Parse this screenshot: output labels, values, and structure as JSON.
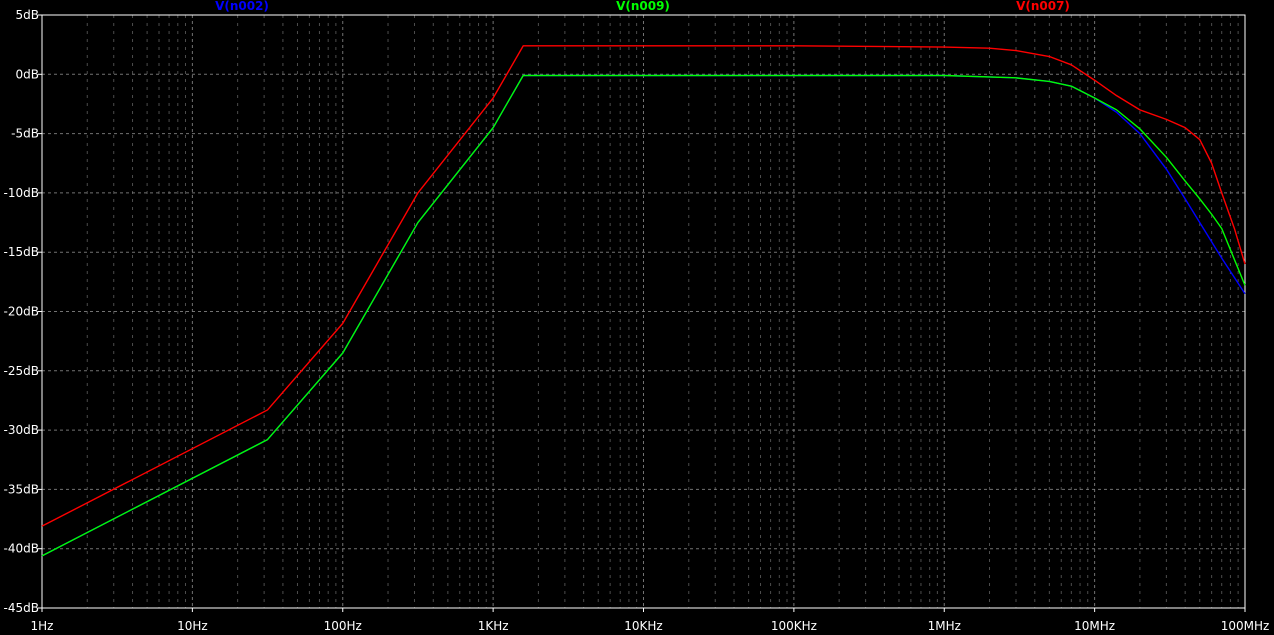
{
  "chart_data": {
    "type": "line",
    "x_scale": "log",
    "xlim": [
      1,
      100000000
    ],
    "ylim": [
      -45,
      5
    ],
    "grid": true,
    "legend_placement": "top",
    "background": "#000000",
    "grid_color": "#808080",
    "x_ticks": [
      {
        "value": 1,
        "label": "1Hz"
      },
      {
        "value": 10,
        "label": "10Hz"
      },
      {
        "value": 100,
        "label": "100Hz"
      },
      {
        "value": 1000,
        "label": "1KHz"
      },
      {
        "value": 10000,
        "label": "10KHz"
      },
      {
        "value": 100000,
        "label": "100KHz"
      },
      {
        "value": 1000000,
        "label": "1MHz"
      },
      {
        "value": 10000000,
        "label": "10MHz"
      },
      {
        "value": 100000000,
        "label": "100MHz"
      }
    ],
    "y_ticks": [
      {
        "value": 5,
        "label": "5dB"
      },
      {
        "value": 0,
        "label": "0dB"
      },
      {
        "value": -5,
        "label": "-5dB"
      },
      {
        "value": -10,
        "label": "-10dB"
      },
      {
        "value": -15,
        "label": "-15dB"
      },
      {
        "value": -20,
        "label": "-20dB"
      },
      {
        "value": -25,
        "label": "-25dB"
      },
      {
        "value": -30,
        "label": "-30dB"
      },
      {
        "value": -35,
        "label": "-35dB"
      },
      {
        "value": -40,
        "label": "-40dB"
      },
      {
        "value": -45,
        "label": "-45dB"
      }
    ],
    "series": [
      {
        "name": "V(n002)",
        "color": "#0000ff",
        "points": [
          [
            1,
            -40.6
          ],
          [
            31.6,
            -30.8
          ],
          [
            100,
            -23.5
          ],
          [
            316,
            -12.5
          ],
          [
            1000,
            -4.5
          ],
          [
            1585,
            -0.1
          ],
          [
            100000,
            -0.1
          ],
          [
            1000000,
            -0.1
          ],
          [
            3000000,
            -0.3
          ],
          [
            5000000,
            -0.6
          ],
          [
            7000000,
            -1.0
          ],
          [
            10000000,
            -2.0
          ],
          [
            14000000,
            -3.2
          ],
          [
            20000000,
            -5.0
          ],
          [
            30000000,
            -8.0
          ],
          [
            40000000,
            -10.5
          ],
          [
            50000000,
            -12.5
          ],
          [
            70000000,
            -15.5
          ],
          [
            100000000,
            -18.5
          ]
        ]
      },
      {
        "name": "V(n009)",
        "color": "#00ff00",
        "points": [
          [
            1,
            -40.6
          ],
          [
            31.6,
            -30.8
          ],
          [
            100,
            -23.5
          ],
          [
            316,
            -12.5
          ],
          [
            1000,
            -4.5
          ],
          [
            1585,
            -0.1
          ],
          [
            100000,
            -0.1
          ],
          [
            1000000,
            -0.1
          ],
          [
            3000000,
            -0.3
          ],
          [
            5000000,
            -0.6
          ],
          [
            7000000,
            -1.0
          ],
          [
            10000000,
            -2.0
          ],
          [
            14000000,
            -3.0
          ],
          [
            20000000,
            -4.6
          ],
          [
            30000000,
            -7.0
          ],
          [
            40000000,
            -9.0
          ],
          [
            50000000,
            -10.5
          ],
          [
            60000000,
            -11.8
          ],
          [
            70000000,
            -13.0
          ],
          [
            100000000,
            -17.8
          ]
        ]
      },
      {
        "name": "V(n007)",
        "color": "#ff0000",
        "points": [
          [
            1,
            -38.1
          ],
          [
            31.6,
            -28.3
          ],
          [
            100,
            -21.0
          ],
          [
            316,
            -10.0
          ],
          [
            1000,
            -2.0
          ],
          [
            1585,
            2.4
          ],
          [
            100000,
            2.4
          ],
          [
            1000000,
            2.3
          ],
          [
            2000000,
            2.2
          ],
          [
            3000000,
            2.0
          ],
          [
            5000000,
            1.5
          ],
          [
            7000000,
            0.8
          ],
          [
            10000000,
            -0.5
          ],
          [
            14000000,
            -1.8
          ],
          [
            20000000,
            -3.0
          ],
          [
            30000000,
            -3.8
          ],
          [
            40000000,
            -4.5
          ],
          [
            50000000,
            -5.5
          ],
          [
            60000000,
            -7.5
          ],
          [
            70000000,
            -10.0
          ],
          [
            85000000,
            -13.0
          ],
          [
            100000000,
            -16.0
          ]
        ]
      }
    ]
  }
}
